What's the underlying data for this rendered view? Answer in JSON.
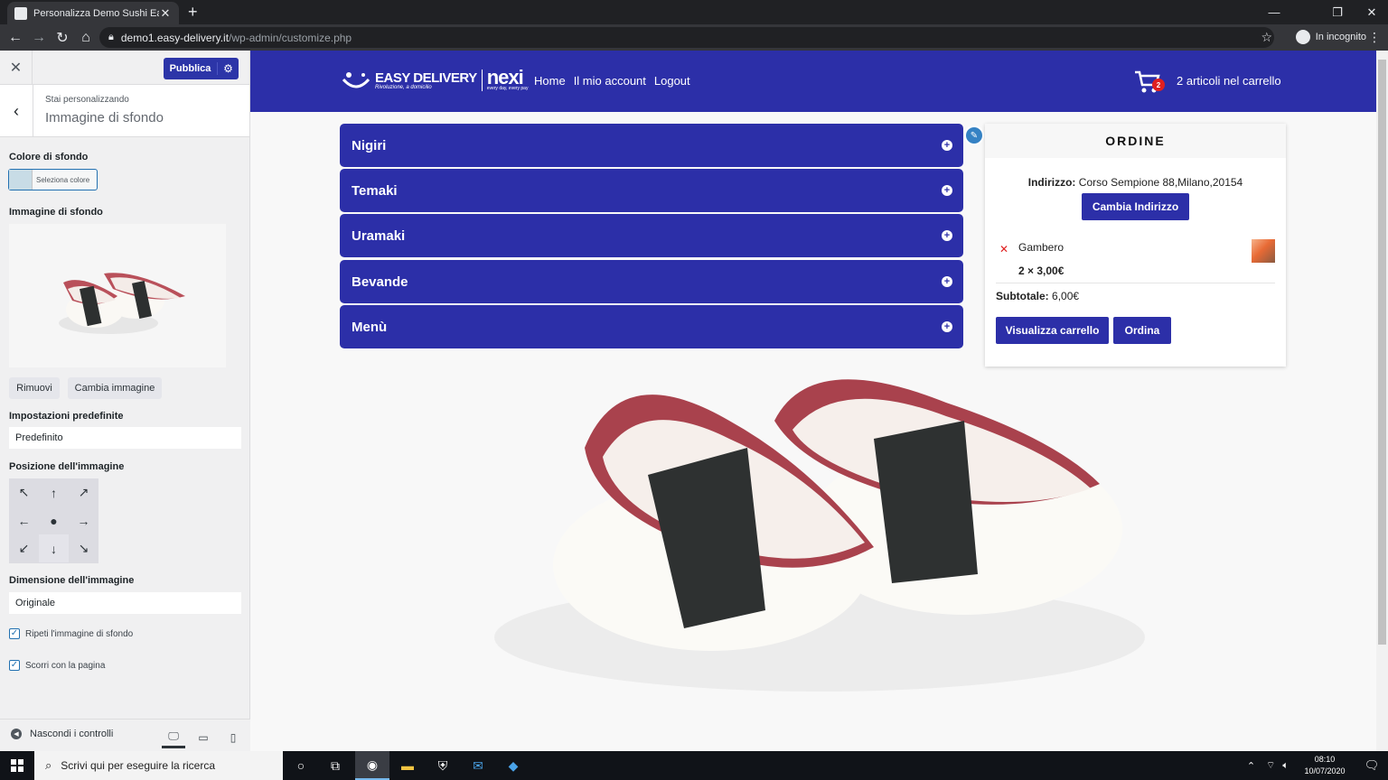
{
  "browser": {
    "tab_title": "Personalizza Demo Sushi Easy De",
    "url_host": "demo1.easy-delivery.it",
    "url_path": "/wp-admin/customize.php",
    "incognito_label": "In incognito"
  },
  "customizer": {
    "publish_label": "Pubblica",
    "customizing_label": "Stai personalizzando",
    "section_title": "Immagine di sfondo",
    "bg_color_label": "Colore di sfondo",
    "select_color_label": "Seleziona colore",
    "bg_color_value": "#c8dce6",
    "bg_image_label": "Immagine di sfondo",
    "remove_label": "Rimuovi",
    "change_image_label": "Cambia immagine",
    "preset_label": "Impostazioni predefinite",
    "preset_value": "Predefinito",
    "position_label": "Posizione dell'immagine",
    "position_selected": "bottom-center",
    "size_label": "Dimensione dell'immagine",
    "size_value": "Originale",
    "repeat_label": "Ripeti l'immagine di sfondo",
    "repeat_checked": true,
    "scroll_label": "Scorri con la pagina",
    "scroll_checked": true,
    "hide_controls_label": "Nascondi i controlli"
  },
  "site": {
    "brand_name": "EASY DELIVERY",
    "brand_tagline": "Rivoluzione, a domicilio",
    "partner_name": "nexi",
    "partner_tagline": "every day, every pay",
    "nav": [
      "Home",
      "Il mio account",
      "Logout"
    ],
    "cart_count": "2",
    "cart_text": "2 articoli nel carrello",
    "accent_color": "#2c2fa8",
    "categories": [
      "Nigiri",
      "Temaki",
      "Uramaki",
      "Bevande",
      "Menù"
    ]
  },
  "order": {
    "title": "ORDINE",
    "address_label": "Indirizzo:",
    "address_value": "Corso Sempione 88,Milano,20154",
    "change_address_label": "Cambia Indirizzo",
    "item_name": "Gambero",
    "item_qty": "2 × 3,00€",
    "subtotal_label": "Subtotale:",
    "subtotal_value": "6,00€",
    "view_cart_label": "Visualizza carrello",
    "order_label": "Ordina"
  },
  "taskbar": {
    "search_placeholder": "Scrivi qui per eseguire la ricerca",
    "time": "08:10",
    "date": "10/07/2020"
  }
}
